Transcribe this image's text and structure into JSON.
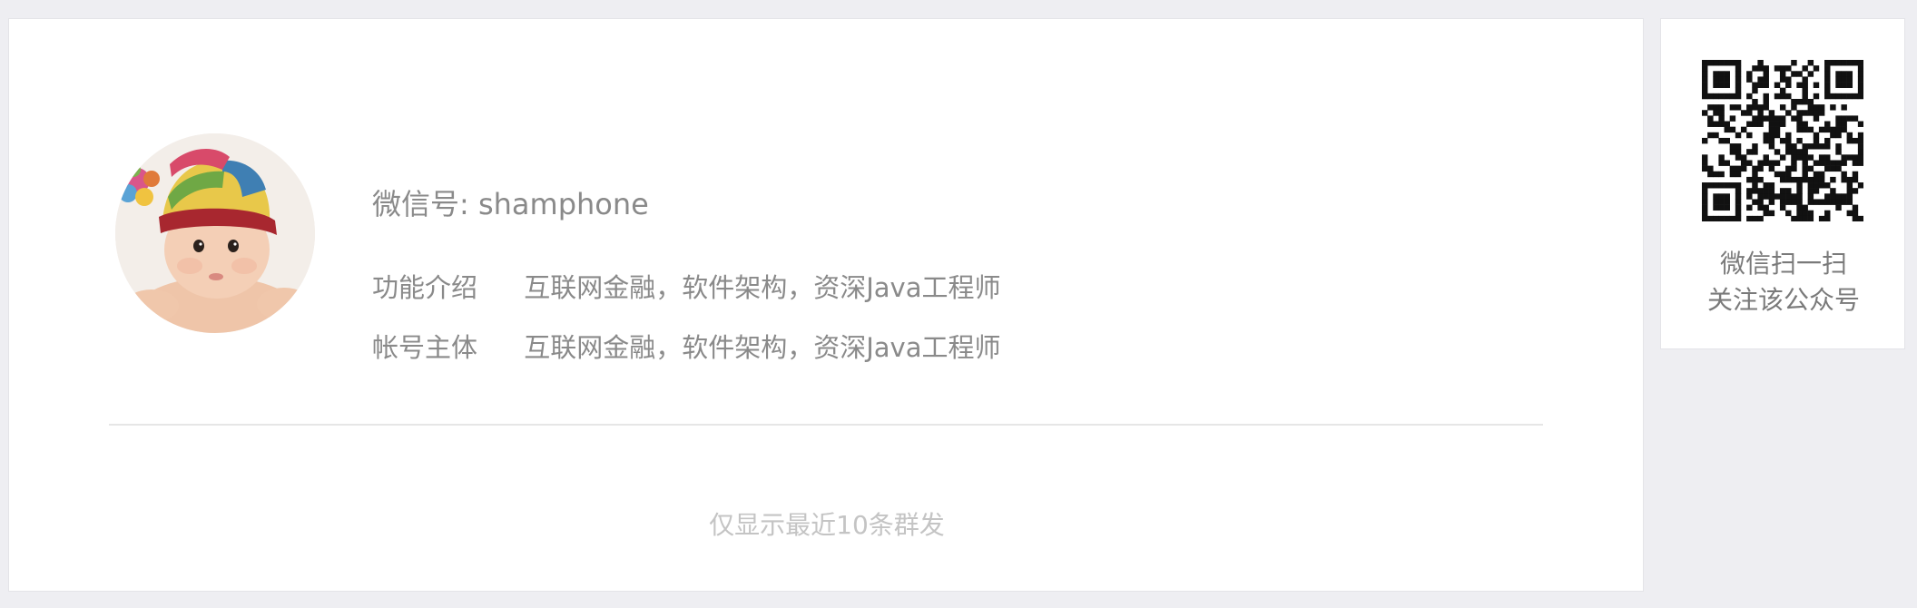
{
  "profile": {
    "wechat_id": "微信号: shamphone",
    "intro_label": "功能介绍",
    "intro_value": "互联网金融，软件架构，资深Java工程师",
    "subject_label": "帐号主体",
    "subject_value": "互联网金融，软件架构，资深Java工程师"
  },
  "notice": "仅显示最近10条群发",
  "qr": {
    "caption_line1": "微信扫一扫",
    "caption_line2": "关注该公众号"
  },
  "icons": {
    "avatar": "baby-photo",
    "qr": "qr-code-icon"
  },
  "colors": {
    "page_background": "#eeeef2",
    "card_background": "#ffffff",
    "text_primary": "#8a8a8a",
    "text_muted": "#c4c4c4"
  }
}
